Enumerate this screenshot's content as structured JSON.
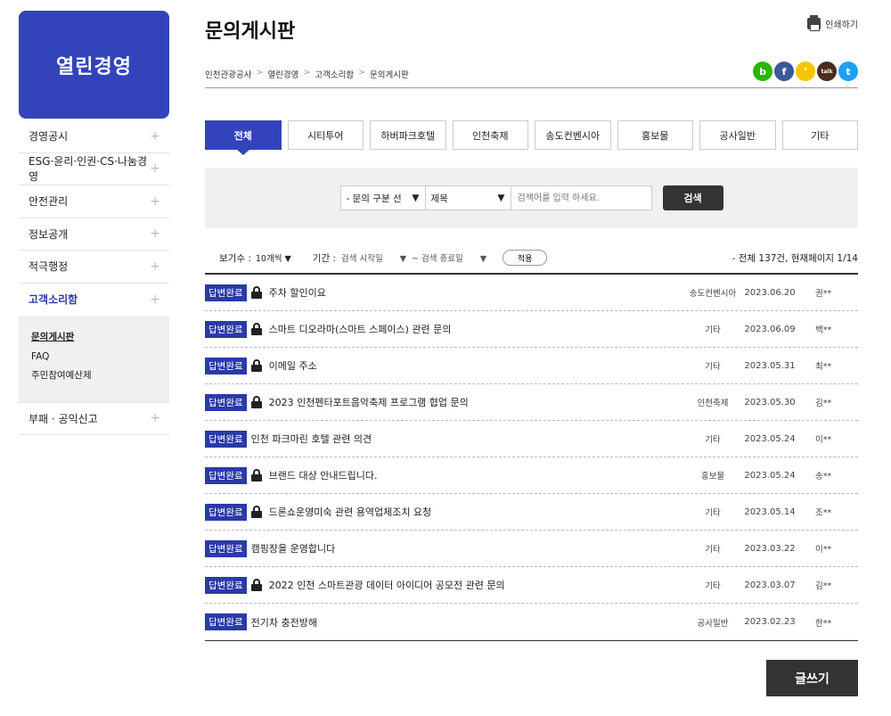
{
  "sidebar": {
    "title": "열린경영",
    "items": [
      {
        "label": "경영공시"
      },
      {
        "label": "ESG·윤리·인권·CS·나눔경영"
      },
      {
        "label": "안전관리"
      },
      {
        "label": "정보공개"
      },
      {
        "label": "적극행정"
      },
      {
        "label": "고객소리함"
      }
    ],
    "sub_items": [
      "문의게시판",
      "FAQ",
      "주민참여예산제"
    ],
    "last_item": "부패 · 공익신고",
    "plus": "+"
  },
  "header": {
    "title": "문의게시판",
    "print_label": "인쇄하기",
    "breadcrumb": [
      "인천관광공사",
      "열린경영",
      "고객소리함",
      "문의게시판"
    ],
    "breadcrumb_sep": ">",
    "social": [
      "b",
      "f",
      "❜",
      "talk",
      "t"
    ]
  },
  "colors": {
    "accent": "#3344bb",
    "badge": "#2a3aa8"
  },
  "tabs": [
    "전체",
    "시티투어",
    "하버파크호텔",
    "인천축제",
    "송도컨벤시아",
    "홍보물",
    "공사일반",
    "기타"
  ],
  "search": {
    "category_select": "- 문의 구분 선",
    "field_select": "제목",
    "placeholder": "검색어를 입력 하세요.",
    "button": "검색"
  },
  "filter": {
    "view_label": "보기수 :",
    "view_value": "10개씩",
    "period_label": "기간 :",
    "start_placeholder": "검색 시작일",
    "end_placeholder": "~ 검색 종료일",
    "apply": "적용",
    "total": "- 전체 137건, 현재페이지 1/14"
  },
  "posts": [
    {
      "status": "답변완료",
      "locked": true,
      "title": "주차 할인이요",
      "category": "송도컨벤시아",
      "date": "2023.06.20",
      "writer": "권**"
    },
    {
      "status": "답변완료",
      "locked": true,
      "title": "스마트 디오라마(스마트 스페이스) 관련 문의",
      "category": "기타",
      "date": "2023.06.09",
      "writer": "백**"
    },
    {
      "status": "답변완료",
      "locked": true,
      "title": "이메일 주소",
      "category": "기타",
      "date": "2023.05.31",
      "writer": "최**"
    },
    {
      "status": "답변완료",
      "locked": true,
      "title": "2023 인천펜타포트음악축제 프로그램 협업 문의",
      "category": "인천축제",
      "date": "2023.05.30",
      "writer": "김**"
    },
    {
      "status": "답변완료",
      "locked": false,
      "title": "인천 파크마린 호텔 관련 의견",
      "category": "기타",
      "date": "2023.05.24",
      "writer": "이**"
    },
    {
      "status": "답변완료",
      "locked": true,
      "title": "브랜드 대상 안내드립니다.",
      "category": "홍보물",
      "date": "2023.05.24",
      "writer": "송**"
    },
    {
      "status": "답변완료",
      "locked": true,
      "title": "드론쇼운영미숙 관련 용역업체조치 요청",
      "category": "기타",
      "date": "2023.05.14",
      "writer": "조**"
    },
    {
      "status": "답변완료",
      "locked": false,
      "title": "캠핑장을 운영합니다",
      "category": "기타",
      "date": "2023.03.22",
      "writer": "이**"
    },
    {
      "status": "답변완료",
      "locked": true,
      "title": "2022 인천 스마트관광 데이터 아이디어 공모전 관련 문의",
      "category": "기타",
      "date": "2023.03.07",
      "writer": "김**"
    },
    {
      "status": "답변완료",
      "locked": false,
      "title": "전기차 충전방해",
      "category": "공사일반",
      "date": "2023.02.23",
      "writer": "한**"
    }
  ],
  "write_button": "글쓰기"
}
